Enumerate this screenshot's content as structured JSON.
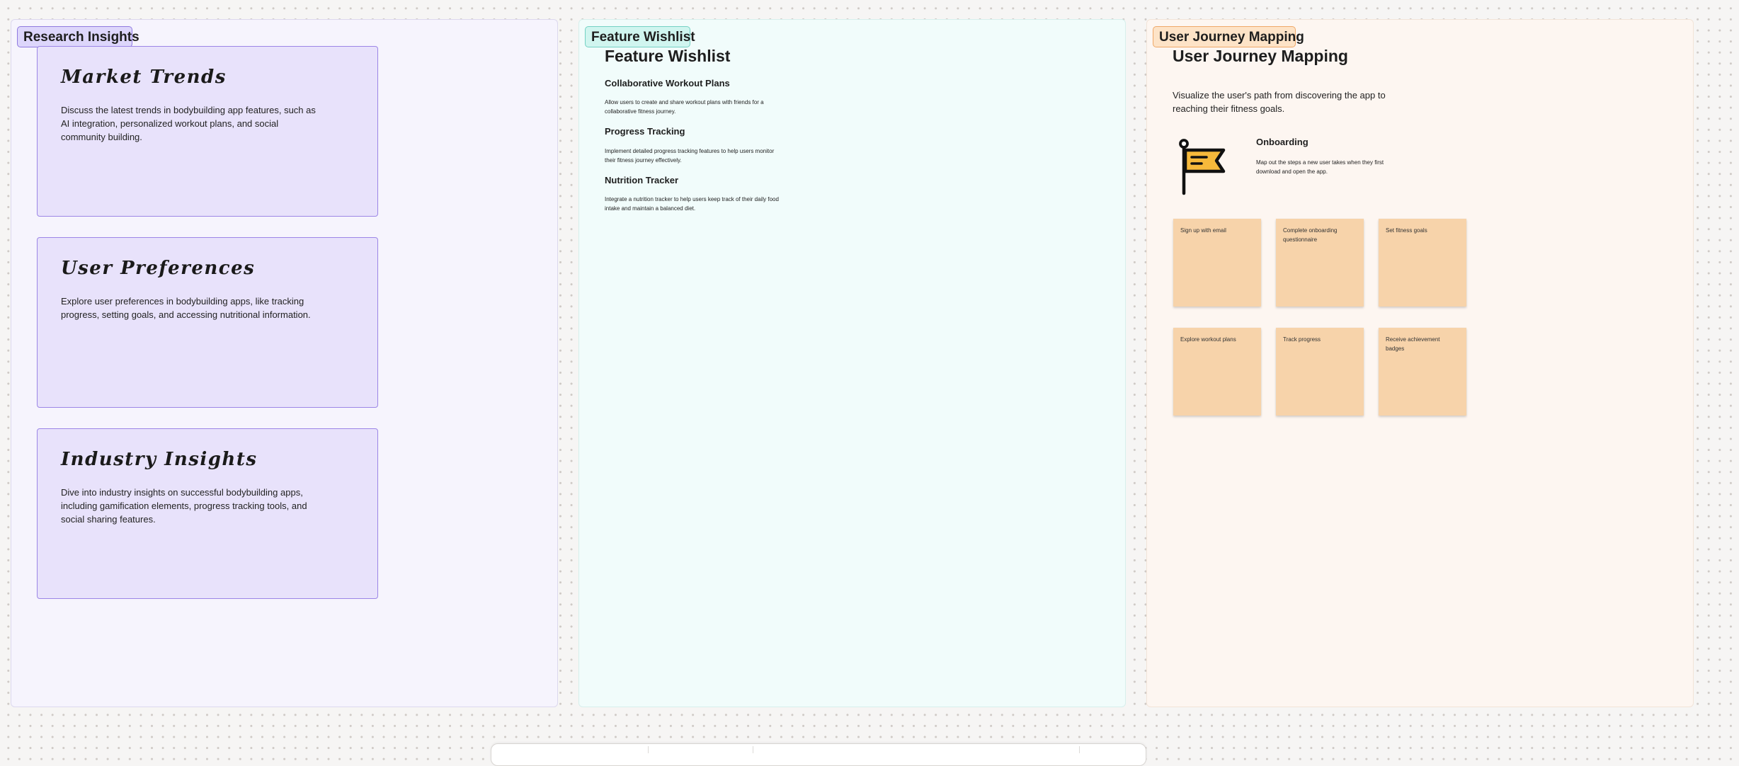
{
  "sections": {
    "research": {
      "label": "Research Insights",
      "cards": [
        {
          "title": "Market Trends",
          "body": "Discuss the latest trends in bodybuilding app features, such as AI integration, personalized workout plans, and social community building."
        },
        {
          "title": "User Preferences",
          "body": "Explore user preferences in bodybuilding apps, like tracking progress, setting goals, and accessing nutritional information."
        },
        {
          "title": "Industry Insights",
          "body": "Dive into industry insights on successful bodybuilding apps, including gamification elements, progress tracking tools, and social sharing features."
        }
      ]
    },
    "wishlist": {
      "label": "Feature Wishlist",
      "heading": "Feature Wishlist",
      "features": [
        {
          "title": "Collaborative Workout Plans",
          "desc": "Allow users to create and share workout plans with friends for a collaborative fitness journey."
        },
        {
          "title": "Progress Tracking",
          "desc": "Implement detailed progress tracking features to help users monitor their fitness journey effectively."
        },
        {
          "title": "Nutrition Tracker",
          "desc": "Integrate a nutrition tracker to help users keep track of their daily food intake and maintain a balanced diet."
        }
      ]
    },
    "journey": {
      "label": "User Journey Mapping",
      "heading": "User Journey Mapping",
      "intro": "Visualize the user's path from discovering the app to reaching their fitness goals.",
      "flag_icon": "flag-icon",
      "step_title": "Onboarding",
      "step_desc": "Map out the steps a new user takes when they first download and open the app.",
      "stickies": [
        "Sign up with email",
        "Complete onboarding questionnaire",
        "Set fitness goals",
        "Explore workout plans",
        "Track progress",
        "Receive achievement badges"
      ]
    }
  },
  "colors": {
    "canvas": "#f6f5f4",
    "research_fill": "#f6f4fd",
    "research_card": "#e8e2fb",
    "research_border": "#9c86e6",
    "wishlist_fill": "#f1fcfb",
    "wishlist_label": "#d0f5ef",
    "journey_fill": "#fdf6f1",
    "journey_label": "#fde3c7",
    "sticky": "#f7d3aa",
    "flag": "#f6b93b"
  }
}
